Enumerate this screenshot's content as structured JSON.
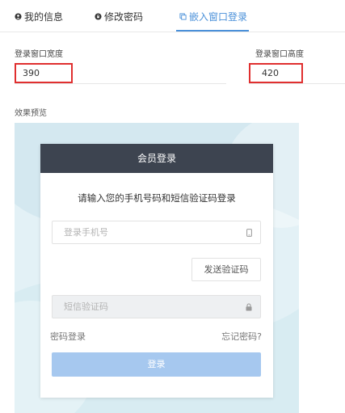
{
  "tabs": [
    {
      "label": "我的信息",
      "icon": "user-circle-icon",
      "active": false
    },
    {
      "label": "修改密码",
      "icon": "lock-circle-icon",
      "active": false
    },
    {
      "label": "嵌入窗口登录",
      "icon": "copy-icon",
      "active": true
    }
  ],
  "settings": {
    "width_label": "登录窗口宽度",
    "width_value": "390",
    "height_label": "登录窗口高度",
    "height_value": "420"
  },
  "preview": {
    "label": "效果预览",
    "card": {
      "title": "会员登录",
      "subtitle": "请输入您的手机号码和短信验证码登录",
      "phone_placeholder": "登录手机号",
      "send_code_label": "发送验证码",
      "code_placeholder": "短信验证码",
      "password_login_link": "密码登录",
      "forgot_password_link": "忘记密码?",
      "login_button": "登录"
    }
  },
  "colors": {
    "accent": "#4a90d9",
    "highlight_border": "#e02f2f",
    "card_header": "#3d4450",
    "login_button": "#a6c8ef"
  }
}
